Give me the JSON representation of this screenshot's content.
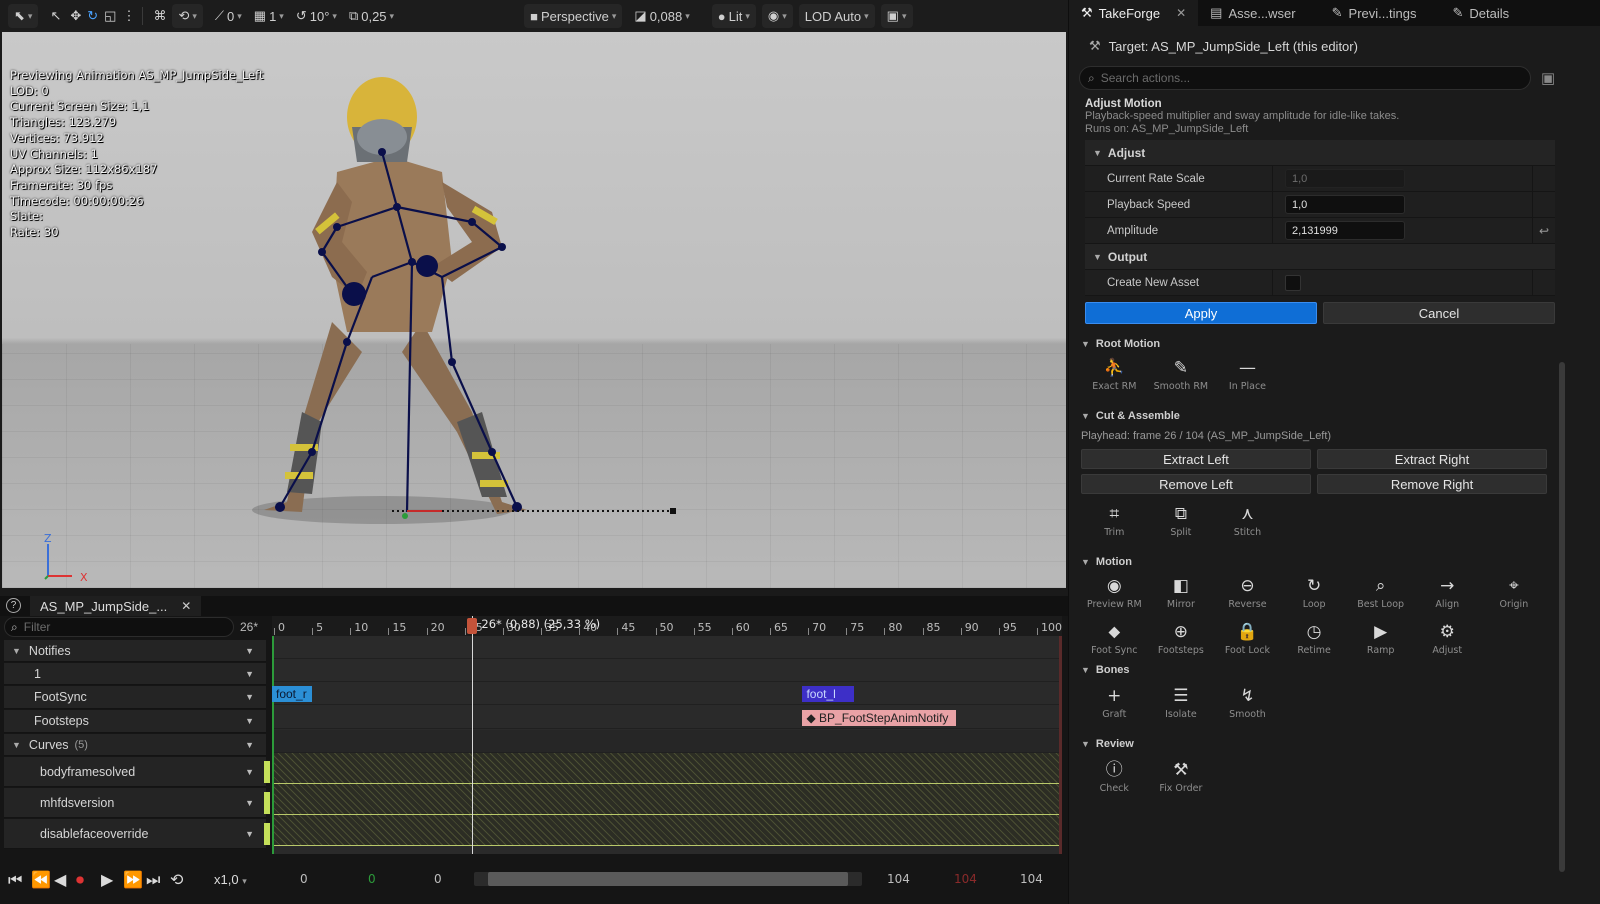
{
  "viewport": {
    "toolbar": {
      "snap_rotate_value": "0",
      "grid_value": "1",
      "rotation_snap": "10°",
      "scale_snap": "0,25",
      "view_mode": "Perspective",
      "camera_speed": "0,088",
      "lighting": "Lit",
      "lod": "LOD Auto"
    },
    "stats": [
      "Previewing Animation AS_MP_JumpSide_Left",
      "LOD: 0",
      "Current Screen Size: 1,1",
      "Triangles: 123.279",
      "Vertices: 73.912",
      "UV Channels: 1",
      "Approx Size: 112x86x187",
      "Framerate: 30 fps",
      "Timecode: 00:00:00:26",
      "Slate:",
      "Rate: 30"
    ],
    "axis": {
      "z": "Z",
      "x": "X"
    }
  },
  "panel": {
    "tabs": [
      {
        "label": "TakeForge",
        "icon": "takeforge-icon"
      },
      {
        "label": "Asse...wser",
        "icon": "asset-browser-icon"
      },
      {
        "label": "Previ...tings",
        "icon": "preview-settings-icon"
      },
      {
        "label": "Details",
        "icon": "details-icon"
      }
    ],
    "target": "Target: AS_MP_JumpSide_Left (this editor)",
    "search_placeholder": "Search actions...",
    "adjust_card": {
      "title": "Adjust Motion",
      "description": "Playback-speed multiplier and sway amplitude for idle-like takes.",
      "runs_on": "Runs on: AS_MP_JumpSide_Left",
      "adjust_label": "Adjust",
      "props": [
        {
          "name": "Current Rate Scale",
          "value": "1,0"
        },
        {
          "name": "Playback Speed",
          "value": "1,0"
        },
        {
          "name": "Amplitude",
          "value": "2,131999"
        }
      ],
      "output_label": "Output",
      "create_new_asset": "Create New Asset",
      "apply": "Apply",
      "cancel": "Cancel"
    },
    "root_motion": {
      "title": "Root Motion",
      "tools": [
        {
          "label": "Exact RM",
          "icon": "exact-rm-icon"
        },
        {
          "label": "Smooth RM",
          "icon": "smooth-rm-icon"
        },
        {
          "label": "In Place",
          "icon": "in-place-icon"
        }
      ]
    },
    "cut_assemble": {
      "title": "Cut & Assemble",
      "playhead": "Playhead: frame 26 / 104  (AS_MP_JumpSide_Left)",
      "buttons": [
        "Extract Left",
        "Extract Right",
        "Remove Left",
        "Remove Right"
      ],
      "tools": [
        {
          "label": "Trim",
          "icon": "trim-icon"
        },
        {
          "label": "Split",
          "icon": "split-icon"
        },
        {
          "label": "Stitch",
          "icon": "stitch-icon"
        }
      ]
    },
    "motion": {
      "title": "Motion",
      "tools": [
        {
          "label": "Preview RM",
          "icon": "preview-rm-icon"
        },
        {
          "label": "Mirror",
          "icon": "mirror-icon"
        },
        {
          "label": "Reverse",
          "icon": "reverse-icon"
        },
        {
          "label": "Loop",
          "icon": "loop-icon"
        },
        {
          "label": "Best Loop",
          "icon": "best-loop-icon"
        },
        {
          "label": "Align",
          "icon": "align-icon"
        },
        {
          "label": "Origin",
          "icon": "origin-icon"
        },
        {
          "label": "Foot Sync",
          "icon": "foot-sync-icon"
        },
        {
          "label": "Footsteps",
          "icon": "footsteps-icon"
        },
        {
          "label": "Foot Lock",
          "icon": "foot-lock-icon"
        },
        {
          "label": "Retime",
          "icon": "retime-icon"
        },
        {
          "label": "Ramp",
          "icon": "ramp-icon"
        },
        {
          "label": "Adjust",
          "icon": "adjust-icon"
        }
      ]
    },
    "bones": {
      "title": "Bones",
      "tools": [
        {
          "label": "Graft",
          "icon": "graft-icon"
        },
        {
          "label": "Isolate",
          "icon": "isolate-icon"
        },
        {
          "label": "Smooth",
          "icon": "smooth-icon"
        }
      ]
    },
    "review": {
      "title": "Review",
      "tools": [
        {
          "label": "Check",
          "icon": "check-icon"
        },
        {
          "label": "Fix Order",
          "icon": "fix-order-icon"
        }
      ]
    }
  },
  "timeline": {
    "tab_label": "AS_MP_JumpSide_...",
    "filter_placeholder": "Filter",
    "current_frame": "26*",
    "playhead_label": "26* (0,88) (25,33 %)",
    "playhead_frame": 26,
    "total_frames": 104,
    "ruler_ticks": [
      "0",
      "5",
      "10",
      "15",
      "20",
      "25",
      "30",
      "35",
      "40",
      "45",
      "50",
      "55",
      "60",
      "65",
      "70",
      "75",
      "80",
      "85",
      "90",
      "95",
      "100"
    ],
    "tracks": {
      "notifies": "Notifies",
      "track_1": "1",
      "footsync": "FootSync",
      "footsteps": "Footsteps",
      "curves": "Curves",
      "curves_count": "(5)",
      "curve_items": [
        "bodyframesolved",
        "mhfdsversion",
        "disablefaceoverride"
      ]
    },
    "notifies": [
      {
        "label": "foot_r",
        "track": "footsync",
        "frame": 0
      },
      {
        "label": "foot_l",
        "track": "footsync",
        "frame": 69
      },
      {
        "label": "BP_FootStepAnimNotify",
        "track": "footsteps",
        "frame": 69
      }
    ],
    "transport": {
      "speed": "x1,0",
      "range_start": "0",
      "range_green": "0",
      "range_mid": "0",
      "range_end": "104",
      "range_red": "104",
      "range_end2": "104"
    }
  },
  "colors": {
    "accent_blue": "#0f6ed6",
    "notify_blue": "#2b8fd6",
    "notify_purple": "#3d2fc7",
    "notify_pink": "#e9a2a6",
    "curve_stripe": "#c5e05a",
    "playhead": "#c4533a"
  }
}
